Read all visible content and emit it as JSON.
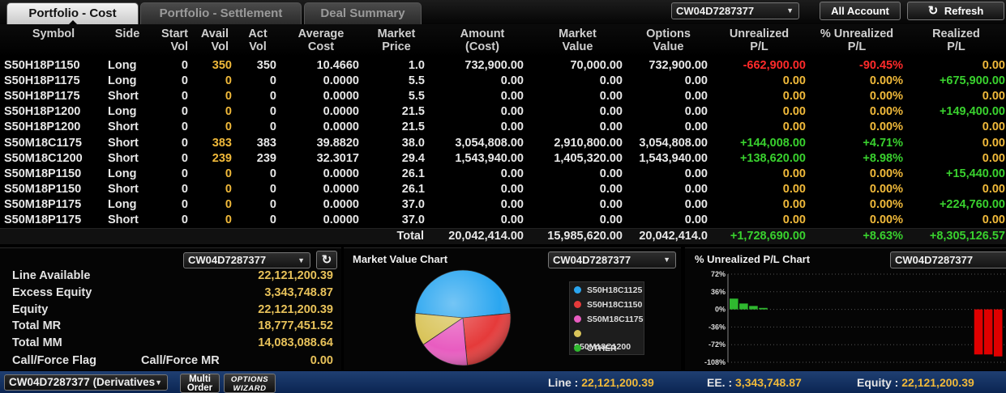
{
  "tabs": [
    {
      "label": "Portfolio - Cost",
      "active": true
    },
    {
      "label": "Portfolio - Settlement",
      "active": false
    },
    {
      "label": "Deal Summary",
      "active": false
    }
  ],
  "account_selector": {
    "value": "CW04D7287377"
  },
  "buttons": {
    "all_account": "All Account",
    "refresh": "Refresh"
  },
  "columns": [
    "Symbol",
    "Side",
    "Start Vol",
    "Avail Vol",
    "Act Vol",
    "Average Cost",
    "Market Price",
    "Amount (Cost)",
    "Market Value",
    "Options Value",
    "Unrealized P/L",
    "% Unrealized P/L",
    "Realized P/L"
  ],
  "column_lines": [
    [
      "Symbol"
    ],
    [
      "Side"
    ],
    [
      "Start",
      "Vol"
    ],
    [
      "Avail",
      "Vol"
    ],
    [
      "Act",
      "Vol"
    ],
    [
      "Average",
      "Cost"
    ],
    [
      "Market",
      "Price"
    ],
    [
      "Amount",
      "(Cost)"
    ],
    [
      "Market",
      "Value"
    ],
    [
      "Options",
      "Value"
    ],
    [
      "Unrealized",
      "P/L"
    ],
    [
      "% Unrealized",
      "P/L"
    ],
    [
      "Realized",
      "P/L"
    ]
  ],
  "rows": [
    {
      "symbol": "S50H18P1150",
      "side": "Long",
      "start_vol": "0",
      "avail_vol": "350",
      "act_vol": "350",
      "avg_cost": "10.4660",
      "mkt_price": "1.0",
      "amount": "732,900.00",
      "mkt_value": "70,000.00",
      "opt_value": "732,900.00",
      "unreal_pl": "-662,900.00",
      "pct_unreal_pl": "-90.45%",
      "real_pl": "0.00",
      "unreal_color": "red",
      "real_color": "yellow"
    },
    {
      "symbol": "S50H18P1175",
      "side": "Long",
      "start_vol": "0",
      "avail_vol": "0",
      "act_vol": "0",
      "avg_cost": "0.0000",
      "mkt_price": "5.5",
      "amount": "0.00",
      "mkt_value": "0.00",
      "opt_value": "0.00",
      "unreal_pl": "0.00",
      "pct_unreal_pl": "0.00%",
      "real_pl": "+675,900.00",
      "unreal_color": "yellow",
      "real_color": "green"
    },
    {
      "symbol": "S50H18P1175",
      "side": "Short",
      "start_vol": "0",
      "avail_vol": "0",
      "act_vol": "0",
      "avg_cost": "0.0000",
      "mkt_price": "5.5",
      "amount": "0.00",
      "mkt_value": "0.00",
      "opt_value": "0.00",
      "unreal_pl": "0.00",
      "pct_unreal_pl": "0.00%",
      "real_pl": "0.00",
      "unreal_color": "yellow",
      "real_color": "yellow"
    },
    {
      "symbol": "S50H18P1200",
      "side": "Long",
      "start_vol": "0",
      "avail_vol": "0",
      "act_vol": "0",
      "avg_cost": "0.0000",
      "mkt_price": "21.5",
      "amount": "0.00",
      "mkt_value": "0.00",
      "opt_value": "0.00",
      "unreal_pl": "0.00",
      "pct_unreal_pl": "0.00%",
      "real_pl": "+149,400.00",
      "unreal_color": "yellow",
      "real_color": "green"
    },
    {
      "symbol": "S50H18P1200",
      "side": "Short",
      "start_vol": "0",
      "avail_vol": "0",
      "act_vol": "0",
      "avg_cost": "0.0000",
      "mkt_price": "21.5",
      "amount": "0.00",
      "mkt_value": "0.00",
      "opt_value": "0.00",
      "unreal_pl": "0.00",
      "pct_unreal_pl": "0.00%",
      "real_pl": "0.00",
      "unreal_color": "yellow",
      "real_color": "yellow"
    },
    {
      "symbol": "S50M18C1175",
      "side": "Short",
      "start_vol": "0",
      "avail_vol": "383",
      "act_vol": "383",
      "avg_cost": "39.8820",
      "mkt_price": "38.0",
      "amount": "3,054,808.00",
      "mkt_value": "2,910,800.00",
      "opt_value": "3,054,808.00",
      "unreal_pl": "+144,008.00",
      "pct_unreal_pl": "+4.71%",
      "real_pl": "0.00",
      "unreal_color": "green",
      "real_color": "yellow"
    },
    {
      "symbol": "S50M18C1200",
      "side": "Short",
      "start_vol": "0",
      "avail_vol": "239",
      "act_vol": "239",
      "avg_cost": "32.3017",
      "mkt_price": "29.4",
      "amount": "1,543,940.00",
      "mkt_value": "1,405,320.00",
      "opt_value": "1,543,940.00",
      "unreal_pl": "+138,620.00",
      "pct_unreal_pl": "+8.98%",
      "real_pl": "0.00",
      "unreal_color": "green",
      "real_color": "yellow"
    },
    {
      "symbol": "S50M18P1150",
      "side": "Long",
      "start_vol": "0",
      "avail_vol": "0",
      "act_vol": "0",
      "avg_cost": "0.0000",
      "mkt_price": "26.1",
      "amount": "0.00",
      "mkt_value": "0.00",
      "opt_value": "0.00",
      "unreal_pl": "0.00",
      "pct_unreal_pl": "0.00%",
      "real_pl": "+15,440.00",
      "unreal_color": "yellow",
      "real_color": "green"
    },
    {
      "symbol": "S50M18P1150",
      "side": "Short",
      "start_vol": "0",
      "avail_vol": "0",
      "act_vol": "0",
      "avg_cost": "0.0000",
      "mkt_price": "26.1",
      "amount": "0.00",
      "mkt_value": "0.00",
      "opt_value": "0.00",
      "unreal_pl": "0.00",
      "pct_unreal_pl": "0.00%",
      "real_pl": "0.00",
      "unreal_color": "yellow",
      "real_color": "yellow"
    },
    {
      "symbol": "S50M18P1175",
      "side": "Long",
      "start_vol": "0",
      "avail_vol": "0",
      "act_vol": "0",
      "avg_cost": "0.0000",
      "mkt_price": "37.0",
      "amount": "0.00",
      "mkt_value": "0.00",
      "opt_value": "0.00",
      "unreal_pl": "0.00",
      "pct_unreal_pl": "0.00%",
      "real_pl": "+224,760.00",
      "unreal_color": "yellow",
      "real_color": "green"
    },
    {
      "symbol": "S50M18P1175",
      "side": "Short",
      "start_vol": "0",
      "avail_vol": "0",
      "act_vol": "0",
      "avg_cost": "0.0000",
      "mkt_price": "37.0",
      "amount": "0.00",
      "mkt_value": "0.00",
      "opt_value": "0.00",
      "unreal_pl": "0.00",
      "pct_unreal_pl": "0.00%",
      "real_pl": "0.00",
      "unreal_color": "yellow",
      "real_color": "yellow"
    }
  ],
  "totals": {
    "label": "Total",
    "amount": "20,042,414.00",
    "mkt_value": "15,985,620.00",
    "opt_value": "20,042,414.0",
    "unreal_pl": "+1,728,690.00",
    "pct_unreal_pl": "+8.63%",
    "real_pl": "+8,305,126.57"
  },
  "account_panel": {
    "selector": "CW04D7287377",
    "items": [
      {
        "label": "Line Available",
        "value": "22,121,200.39"
      },
      {
        "label": "Excess Equity",
        "value": "3,343,748.87"
      },
      {
        "label": "Equity",
        "value": "22,121,200.39"
      },
      {
        "label": "Total MR",
        "value": "18,777,451.52"
      },
      {
        "label": "Total MM",
        "value": "14,083,088.64"
      }
    ],
    "flag_label": "Call/Force Flag",
    "mr_label": "Call/Force MR",
    "mr_value": "0.00"
  },
  "market_value_chart": {
    "title": "Market Value Chart",
    "selector": "CW04D7287377",
    "legend": [
      {
        "name": "S50H18C1125",
        "color": "#2aa6f0"
      },
      {
        "name": "S50H18C1150",
        "color": "#e53a3a"
      },
      {
        "name": "S50M18C1175",
        "color": "#e85cc0"
      },
      {
        "name": "S50M18C1200",
        "color": "#d9c45a"
      },
      {
        "name": "OTHER",
        "color": "#2fb82f"
      }
    ]
  },
  "unrealized_chart": {
    "title": "% Unrealized P/L Chart",
    "selector": "CW04D7287377"
  },
  "chart_data": [
    {
      "type": "pie",
      "categories": [
        "S50H18C1125",
        "S50H18C1150",
        "S50M18C1175",
        "S50M18C1200",
        "OTHER"
      ],
      "values": [
        47,
        25,
        17,
        11,
        0
      ]
    },
    {
      "type": "bar",
      "ylim": [
        -108,
        72
      ],
      "yticks": [
        "72%",
        "36%",
        "0%",
        "-36%",
        "-72%",
        "-108%"
      ],
      "ytick_values": [
        72,
        36,
        0,
        -36,
        -72,
        -108
      ],
      "values": [
        22,
        12,
        7,
        3,
        0,
        0,
        0,
        0,
        0,
        0,
        0,
        0,
        0,
        0,
        0,
        0,
        0,
        0,
        0,
        0,
        0,
        0,
        0,
        0,
        0,
        -92,
        -92,
        -96
      ],
      "colors": {
        "positive": "#2fb82f",
        "negative": "#e00000"
      }
    }
  ],
  "status_bar": {
    "account": "CW04D7287377 (Derivatives",
    "multi_order": "Multi Order",
    "options_wizard": "OPTIONS WIZARD",
    "line_label": "Line :",
    "line_value": "22,121,200.39",
    "ee_label": "EE. :",
    "ee_value": "3,343,748.87",
    "equity_label": "Equity :",
    "equity_value": "22,121,200.39"
  }
}
